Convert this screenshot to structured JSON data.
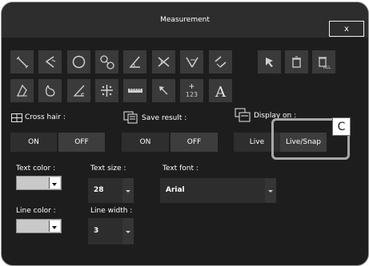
{
  "window": {
    "title": "Measurement",
    "close_label": "x"
  },
  "toolbar": {
    "row1": [
      "line-icon",
      "angle-line-icon",
      "circle-icon",
      "circle-to-circle-icon",
      "angle-icon",
      "cross-angle-icon",
      "four-point-angle-icon",
      "parallel-icon"
    ],
    "row1_extra": [
      "pointer-icon",
      "delete-icon",
      "delete-all-icon"
    ],
    "row2": [
      "polygon-icon",
      "freehand-icon",
      "right-angle-icon",
      "point-distance-icon",
      "ruler-icon",
      "arrow-icon",
      "counter-icon",
      "text-icon"
    ],
    "counter_label": "123",
    "text_label": "A",
    "trash_all_label": "ALL"
  },
  "cross_hair": {
    "label": "Cross hair :",
    "on": "ON",
    "off": "OFF"
  },
  "save_result": {
    "label": "Save result :",
    "on": "ON",
    "off": "OFF"
  },
  "display_on": {
    "label": "Display on :",
    "live": "Live",
    "live_snap": "Live/Snap"
  },
  "text_color": {
    "label": "Text color :"
  },
  "text_size": {
    "label": "Text size :",
    "value": "28"
  },
  "text_font": {
    "label": "Text font :",
    "value": "Arial"
  },
  "line_color": {
    "label": "Line color :"
  },
  "line_width": {
    "label": "Line width :",
    "value": "3"
  },
  "callout": {
    "label": "C"
  },
  "colors": {
    "panel": "#1d1d1d",
    "button_dark": "#2e2e2e",
    "button_light": "#3d3d3d",
    "swatch": "#c9c9c9"
  }
}
